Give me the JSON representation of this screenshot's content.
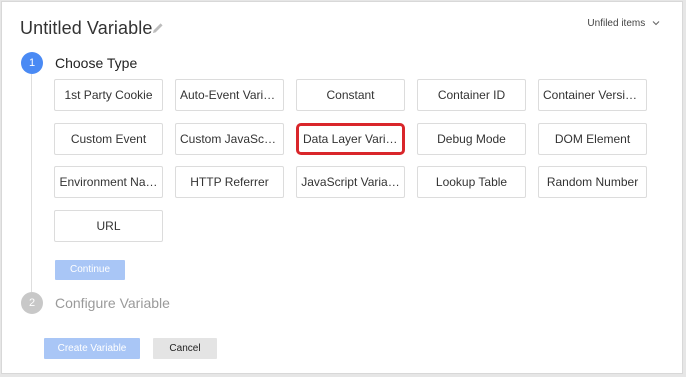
{
  "header": {
    "title": "Untitled Variable",
    "folder_label": "Unfiled items"
  },
  "steps": [
    {
      "number": "1",
      "label": "Choose Type",
      "state": "active"
    },
    {
      "number": "2",
      "label": "Configure Variable",
      "state": "inactive"
    }
  ],
  "variable_types": [
    "1st Party Cookie",
    "Auto-Event Varia…",
    "Constant",
    "Container ID",
    "Container Versio…",
    "Custom Event",
    "Custom JavaScri…",
    "Data Layer Varia…",
    "Debug Mode",
    "DOM Element",
    "Environment Na…",
    "HTTP Referrer",
    "JavaScript Varia…",
    "Lookup Table",
    "Random Number",
    "URL"
  ],
  "selected_type": "Data Layer Varia…",
  "buttons": {
    "continue": "Continue",
    "create": "Create Variable",
    "cancel": "Cancel"
  },
  "colors": {
    "accent": "#4a8af4",
    "button_disabled": "#a9c6f6",
    "highlight": "#d9262a"
  },
  "icons": {
    "edit": "pencil-icon",
    "folder_dropdown": "chevron-down-icon"
  }
}
